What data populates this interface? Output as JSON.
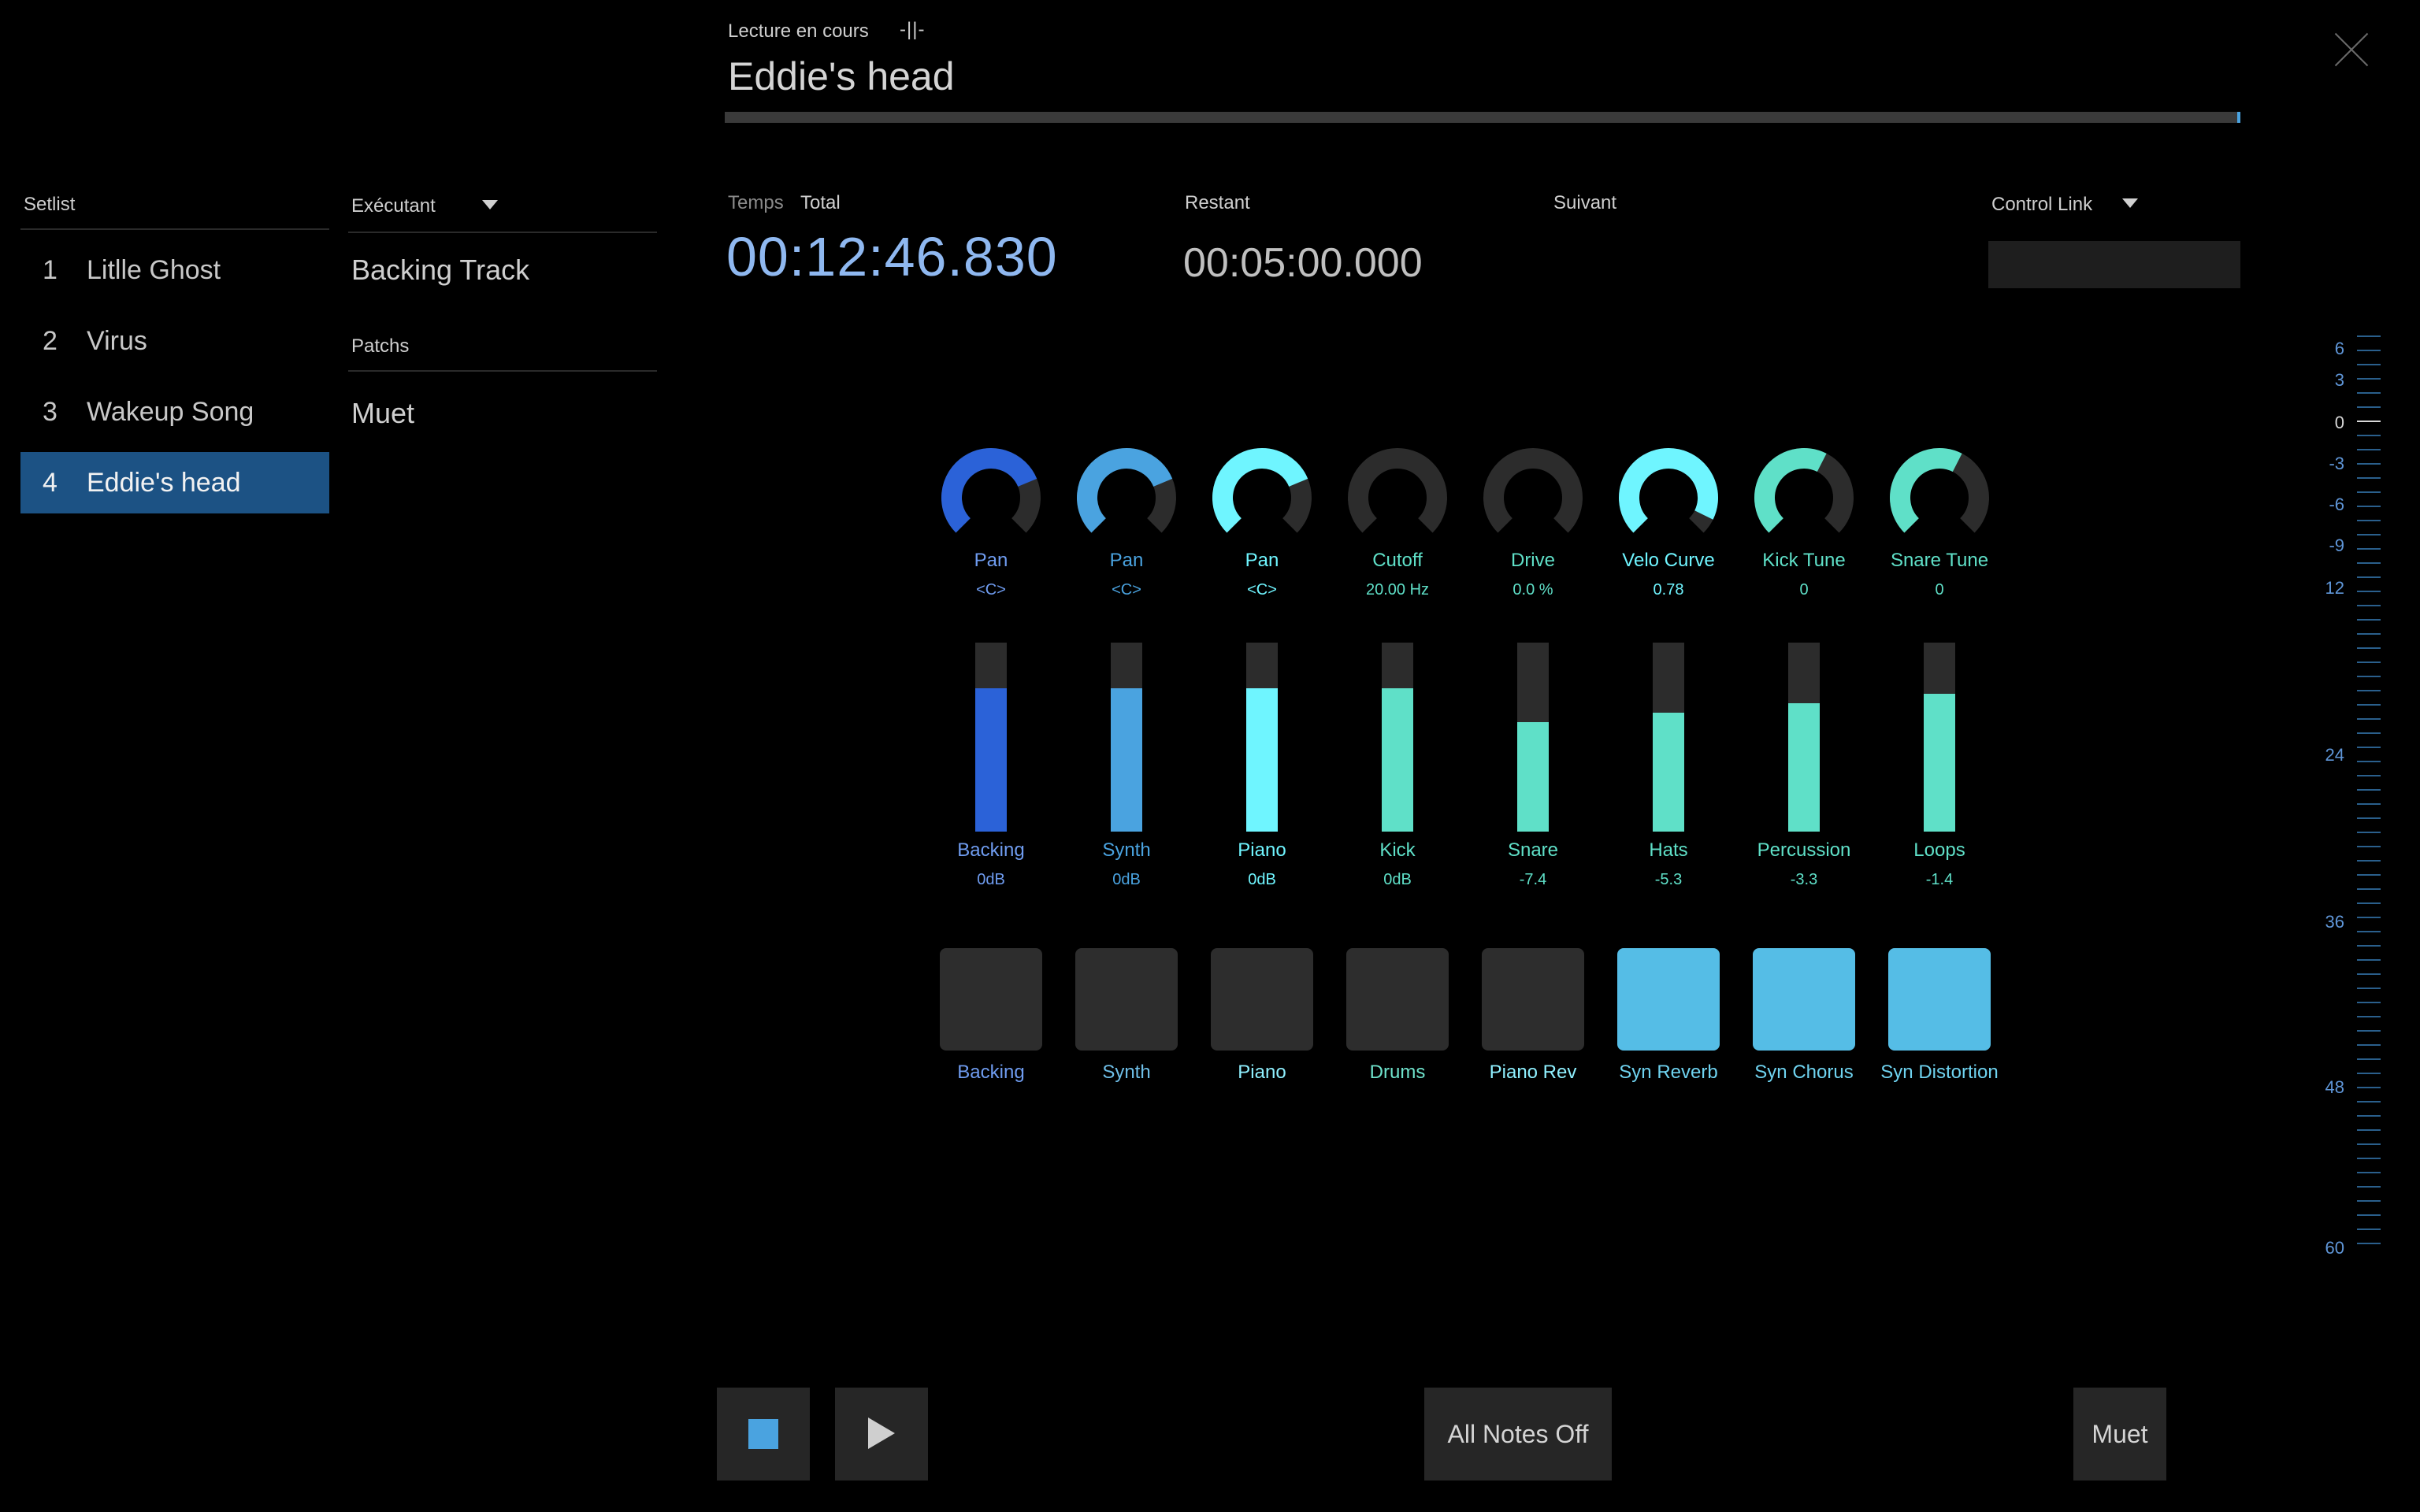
{
  "colors": {
    "background": "#000000",
    "selection": "#1c5284",
    "accent_blue": "#2b62d8",
    "accent_sky": "#4aa3e0",
    "accent_cyan": "#6ff5ff",
    "accent_teal": "#5fe0c8",
    "pad_on": "#55bde6",
    "pad_off": "#2d2d2d",
    "dark_track": "#2c2c2c"
  },
  "header": {
    "now_playing_label": "Lecture en cours",
    "marker": "-||-",
    "song_title": "Eddie's head",
    "progress_fraction": 0.999,
    "close_icon": "close-icon"
  },
  "setlist": {
    "header": "Setlist",
    "items": [
      {
        "num": "1",
        "name": "Litlle Ghost"
      },
      {
        "num": "2",
        "name": "Virus"
      },
      {
        "num": "3",
        "name": "Wakeup Song"
      },
      {
        "num": "4",
        "name": "Eddie's head"
      }
    ],
    "selected_index": 3
  },
  "performer": {
    "header": "Exécutant",
    "value": "Backing Track",
    "patches_header": "Patchs",
    "patch_value": "Muet"
  },
  "timing": {
    "temps_label": "Temps",
    "total_label": "Total",
    "total_value": "00:12:46.830",
    "remaining_label": "Restant",
    "remaining_value": "00:05:00.000",
    "next_label": "Suivant",
    "control_link_label": "Control Link"
  },
  "knobs": [
    {
      "label": "Pan",
      "value": "<C>",
      "color": "#2b62d8",
      "level": 0.75
    },
    {
      "label": "Pan",
      "value": "<C>",
      "color": "#4aa3e0",
      "level": 0.75
    },
    {
      "label": "Pan",
      "value": "<C>",
      "color": "#6ff5ff",
      "level": 0.75
    },
    {
      "label": "Cutoff",
      "value": "20.00 Hz",
      "color": "#5fe0c8",
      "level": 0
    },
    {
      "label": "Drive",
      "value": "0.0 %",
      "color": "#5fe0c8",
      "level": 0
    },
    {
      "label": "Velo Curve",
      "value": "0.78",
      "color": "#6ff5ff",
      "level": 0.93
    },
    {
      "label": "Kick Tune",
      "value": "0",
      "color": "#5fe0c8",
      "level": 0.6
    },
    {
      "label": "Snare Tune",
      "value": "0",
      "color": "#5fe0c8",
      "level": 0.6
    }
  ],
  "faders": [
    {
      "label": "Backing",
      "value": "0dB",
      "color": "#2b62d8",
      "level": 0.76
    },
    {
      "label": "Synth",
      "value": "0dB",
      "color": "#4aa3e0",
      "level": 0.76
    },
    {
      "label": "Piano",
      "value": "0dB",
      "color": "#6ff5ff",
      "level": 0.76
    },
    {
      "label": "Kick",
      "value": "0dB",
      "color": "#5fe0c8",
      "level": 0.76
    },
    {
      "label": "Snare",
      "value": "-7.4",
      "color": "#5fe0c8",
      "level": 0.58
    },
    {
      "label": "Hats",
      "value": "-5.3",
      "color": "#5fe0c8",
      "level": 0.63
    },
    {
      "label": "Percussion",
      "value": "-3.3",
      "color": "#5fe0c8",
      "level": 0.68
    },
    {
      "label": "Loops",
      "value": "-1.4",
      "color": "#5fe0c8",
      "level": 0.73
    }
  ],
  "pads": [
    {
      "label": "Backing",
      "on": false,
      "label_color": "#6f9cf0"
    },
    {
      "label": "Synth",
      "on": false,
      "label_color": "#6fbfe8"
    },
    {
      "label": "Piano",
      "on": false,
      "label_color": "#8ff0ff"
    },
    {
      "label": "Drums",
      "on": false,
      "label_color": "#6fe3cc"
    },
    {
      "label": "Piano Rev",
      "on": false,
      "label_color": "#8ff0ff"
    },
    {
      "label": "Syn Reverb",
      "on": true,
      "label_color": "#6fd3f0"
    },
    {
      "label": "Syn Chorus",
      "on": true,
      "label_color": "#6fd3f0"
    },
    {
      "label": "Syn Distortion",
      "on": true,
      "label_color": "#6fd3f0"
    }
  ],
  "meter": {
    "labels": [
      "6",
      "3",
      "0",
      "-3",
      "-6",
      "-9",
      "12",
      "24",
      "36",
      "48",
      "60"
    ]
  },
  "transport": {
    "stop_icon": "stop-icon",
    "play_icon": "play-icon",
    "all_notes_off_label": "All Notes Off",
    "mute_label": "Muet"
  }
}
